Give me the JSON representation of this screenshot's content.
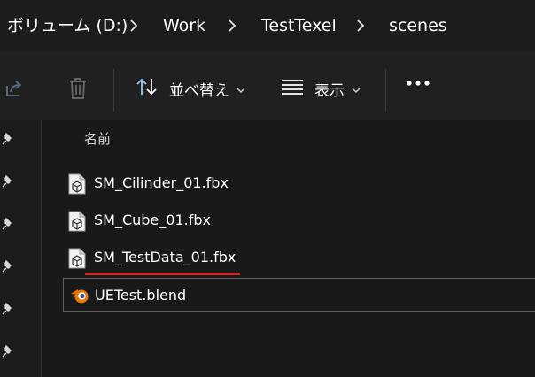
{
  "breadcrumb": {
    "items": [
      "ボリューム (D:)",
      "Work",
      "TestTexel",
      "scenes"
    ]
  },
  "toolbar": {
    "sort_label": "並べ替え",
    "view_label": "表示"
  },
  "list": {
    "column_name": "名前",
    "files": [
      {
        "name": "SM_Cilinder_01.fbx",
        "icon": "fbx-file-icon"
      },
      {
        "name": "SM_Cube_01.fbx",
        "icon": "fbx-file-icon"
      },
      {
        "name": "SM_TestData_01.fbx",
        "icon": "fbx-file-icon"
      },
      {
        "name": "UETest.blend",
        "icon": "blender-file-icon"
      }
    ]
  },
  "colors": {
    "annotation_underline": "#d0262a",
    "blender_orange": "#ea7600",
    "background": "#191919"
  }
}
